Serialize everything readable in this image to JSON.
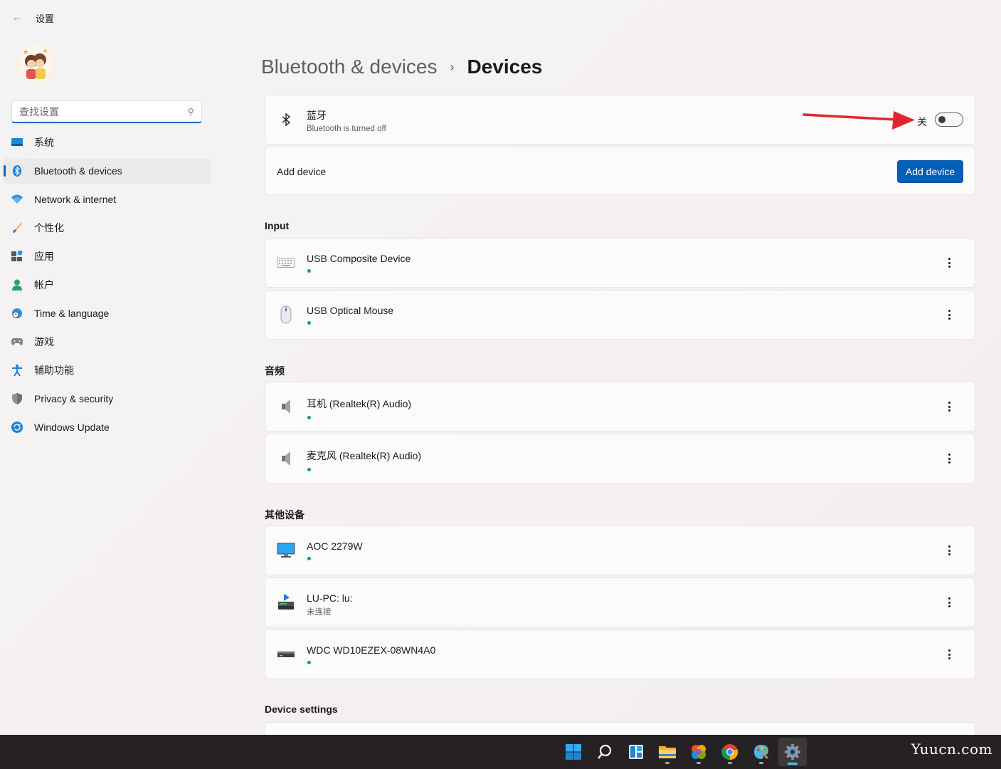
{
  "app": {
    "title": "设置"
  },
  "sidebar": {
    "search_placeholder": "查找设置",
    "items": [
      {
        "label": "系统",
        "icon": "system-icon"
      },
      {
        "label": "Bluetooth & devices",
        "icon": "bluetooth-icon",
        "active": true
      },
      {
        "label": "Network & internet",
        "icon": "wifi-icon"
      },
      {
        "label": "个性化",
        "icon": "brush-icon"
      },
      {
        "label": "应用",
        "icon": "apps-icon"
      },
      {
        "label": "帐户",
        "icon": "account-icon"
      },
      {
        "label": "Time & language",
        "icon": "clock-globe-icon"
      },
      {
        "label": "游戏",
        "icon": "gamepad-icon"
      },
      {
        "label": "辅助功能",
        "icon": "accessibility-icon"
      },
      {
        "label": "Privacy & security",
        "icon": "shield-icon"
      },
      {
        "label": "Windows Update",
        "icon": "update-icon"
      }
    ]
  },
  "breadcrumb": {
    "parent": "Bluetooth & devices",
    "separator": "›",
    "current": "Devices"
  },
  "bluetooth": {
    "title": "蓝牙",
    "subtitle": "Bluetooth is turned off",
    "toggle_label": "关",
    "toggle_on": false
  },
  "add_device": {
    "label": "Add device",
    "button": "Add device"
  },
  "sections": {
    "input": {
      "label": "Input",
      "devices": [
        {
          "name": "USB Composite Device",
          "icon": "keyboard-icon"
        },
        {
          "name": "USB Optical Mouse",
          "icon": "mouse-icon"
        }
      ]
    },
    "audio": {
      "label": "音频",
      "devices": [
        {
          "name": "耳机 (Realtek(R) Audio)",
          "icon": "speaker-icon"
        },
        {
          "name": "麦克风 (Realtek(R) Audio)",
          "icon": "speaker-icon"
        }
      ]
    },
    "other": {
      "label": "其他设备",
      "devices": [
        {
          "name": "AOC 2279W",
          "icon": "monitor-icon"
        },
        {
          "name": "LU-PC: lu:",
          "status": "未连接",
          "icon": "media-server-icon"
        },
        {
          "name": "WDC WD10EZEX-08WN4A0",
          "icon": "drive-icon"
        }
      ]
    },
    "device_settings": {
      "label": "Device settings"
    }
  },
  "taskbar": {
    "icons": [
      "start-icon",
      "search-icon",
      "widgets-icon",
      "file-explorer-icon",
      "photos-icon",
      "chrome-icon",
      "paint-icon",
      "settings-icon"
    ]
  },
  "watermark": "Yuucn.com",
  "colors": {
    "accent": "#005fb8",
    "status_green": "#0fa650",
    "arrow": "#e0262c"
  }
}
